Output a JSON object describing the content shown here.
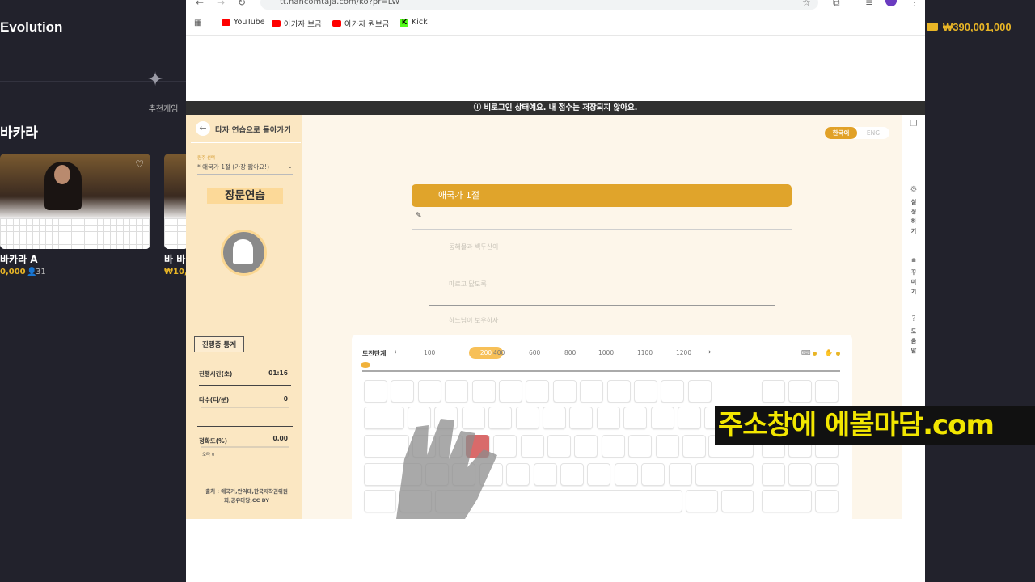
{
  "bg": {
    "brand": "Evolution",
    "balance": "₩390,001,000",
    "recommend_label": "추천게임",
    "section_title": "바카라",
    "games": [
      {
        "name": "바카라 A",
        "min": "0,000",
        "players": "31"
      },
      {
        "name": "바 바",
        "min": "₩10,",
        "players": ""
      }
    ]
  },
  "browser": {
    "url": "tt.hancomtaja.com/ko?pr=LW",
    "bookmarks": [
      {
        "label": "YouTube",
        "icon": "youtube-icon"
      },
      {
        "label": "아카자 브금",
        "icon": "youtube-icon"
      },
      {
        "label": "아카자 퀀브금",
        "icon": "youtube-icon"
      },
      {
        "label": "Kick",
        "icon": "kick-icon"
      }
    ],
    "warning": "ⓘ 비로그인 상태예요. 내 점수는 저장되지 않아요."
  },
  "app": {
    "back_label": "타자 연습으로 돌아가기",
    "select_label": "원주 선택",
    "select_value": "* 애국가 1절 (가장 짧아요!)",
    "mode_title": "장문연습",
    "lang_ko": "한국어",
    "lang_en": "ENG",
    "song_title": "애국가 1절",
    "lyrics": [
      "동해물과 백두산이",
      "마르고 닳도록",
      "하느님이 보우하사"
    ],
    "stats_title": "진행중 통계",
    "stats": [
      {
        "label": "진행시간(초)",
        "value": "01:16"
      },
      {
        "label": "타수(타/분)",
        "value": "0"
      },
      {
        "label": "정확도(%)",
        "value": "0.00"
      }
    ],
    "typo_label": "오타 0",
    "source": "출처 : 애국가,안익태,한국저작권위원회,공유마당,CC BY",
    "right_menu": [
      {
        "icon": "gear-icon",
        "label": "설정하기"
      },
      {
        "icon": "lock-icon",
        "label": "꾸미기"
      },
      {
        "icon": "help-icon",
        "label": "도움말"
      }
    ],
    "keyboard": {
      "stage_label": "도전단계",
      "speeds": [
        "100",
        "200",
        "400",
        "600",
        "800",
        "1000",
        "1100",
        "1200"
      ],
      "active_speed": "200"
    }
  },
  "overlay": {
    "ad_text": "주소창에 에볼마담.com"
  }
}
